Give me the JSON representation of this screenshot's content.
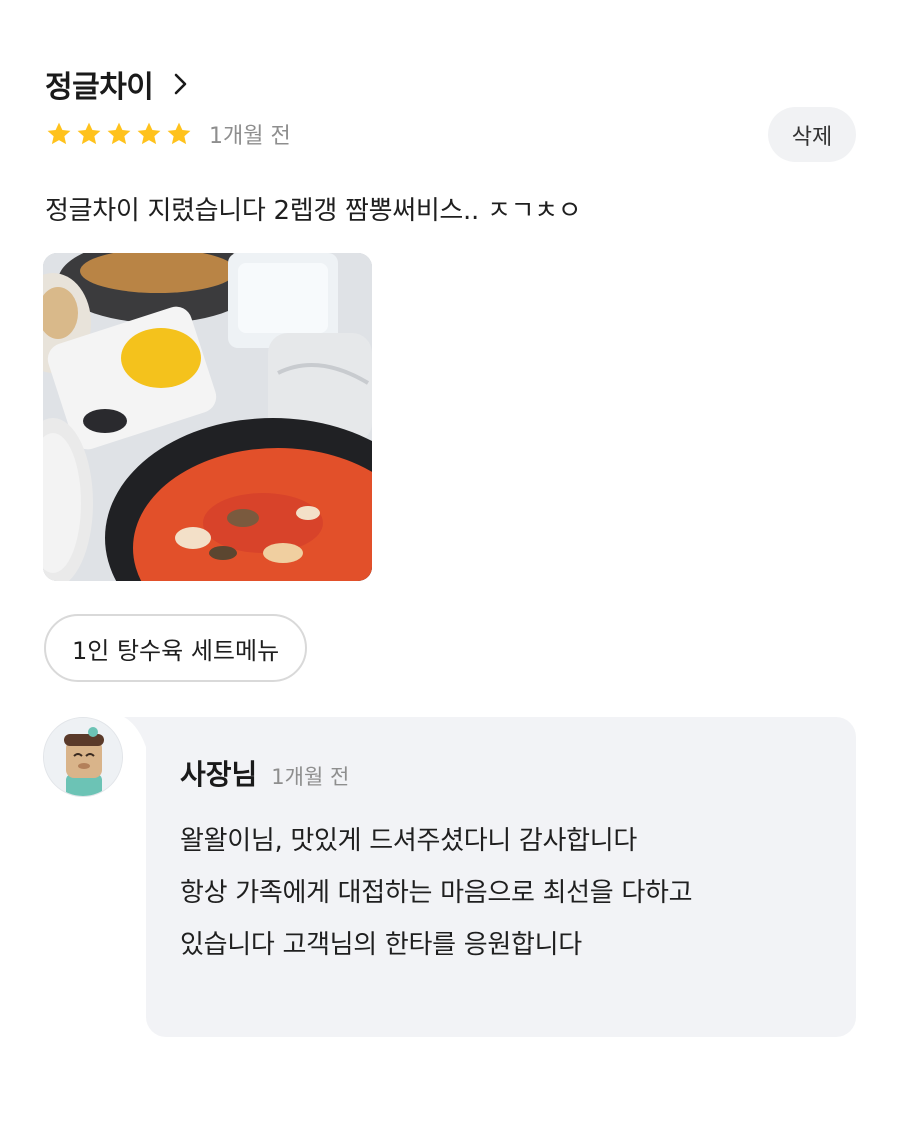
{
  "review": {
    "store_name": "정글차이",
    "rating": 5,
    "stars_shown": 5,
    "date": "1개월 전",
    "delete_label": "삭제",
    "text": "정글차이 지렸습니다 2렙갱 짬뽕써비스.. ㅈㄱㅊㅇ",
    "menu_chip": "1인 탕수육 세트메뉴"
  },
  "owner_reply": {
    "name": "사장님",
    "date": "1개월 전",
    "lines": [
      "왈왈이님, 맛있게 드셔주셨다니 감사합니다",
      "항상 가족에게 대접하는 마음으로 최선을 다하고",
      "있습니다 고객님의 한타를 응원합니다"
    ]
  },
  "colors": {
    "star": "#FFC21C",
    "muted_text": "#8E8E8E",
    "reply_bg": "#F2F3F6",
    "chip_border": "#D9D9D9"
  },
  "icons": {
    "chevron": "chevron-right-icon",
    "star": "star-icon"
  }
}
